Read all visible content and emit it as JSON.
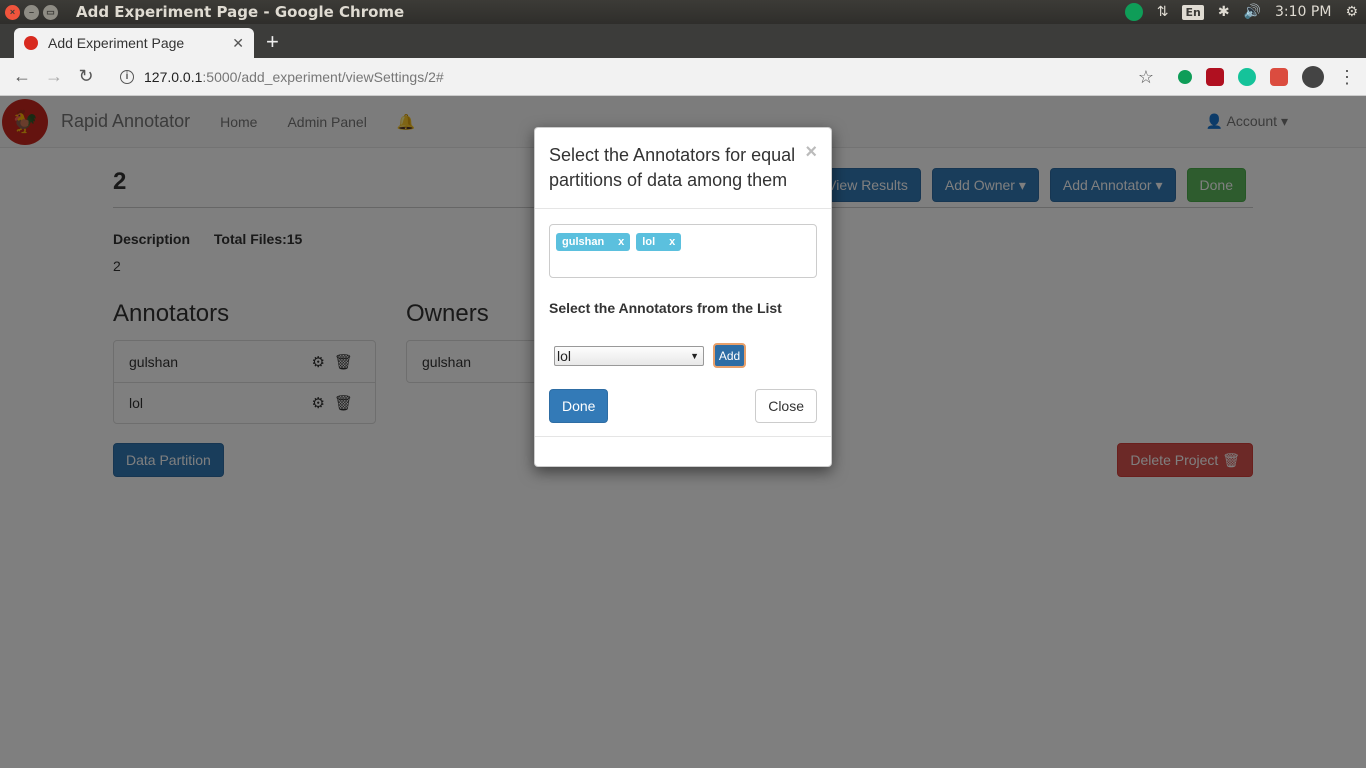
{
  "os": {
    "window_title": "Add Experiment Page - Google Chrome",
    "lang": "En",
    "clock": "3:10 PM"
  },
  "browser": {
    "tab_title": "Add Experiment Page",
    "url_host": "127.0.0.1",
    "url_path": ":5000/add_experiment/viewSettings/2#"
  },
  "navbar": {
    "brand": "Rapid Annotator",
    "home": "Home",
    "admin": "Admin Panel",
    "account": "Account"
  },
  "project": {
    "title": "2",
    "description_label": "Description",
    "total_files_label": "Total Files:15",
    "description_value": "2",
    "buttons": {
      "view_results": "View Results",
      "add_owner": "Add Owner",
      "add_annotator": "Add Annotator",
      "done": "Done"
    },
    "annotators_title": "Annotators",
    "annotators": [
      "gulshan",
      "lol"
    ],
    "owners_title": "Owners",
    "owners": [
      "gulshan"
    ],
    "data_partition": "Data Partition",
    "delete_project": "Delete Project"
  },
  "modal": {
    "title": "Select the Annotators for equal partitions of data among them",
    "tags": [
      "gulshan",
      "lol"
    ],
    "list_label": "Select the Annotators from the List",
    "select_value": "lol",
    "add_label": "Add",
    "done_label": "Done",
    "close_label": "Close"
  },
  "colors": {
    "primary": "#337ab7",
    "success": "#5cb85c",
    "danger": "#d9534f",
    "tag": "#5bc0de"
  }
}
